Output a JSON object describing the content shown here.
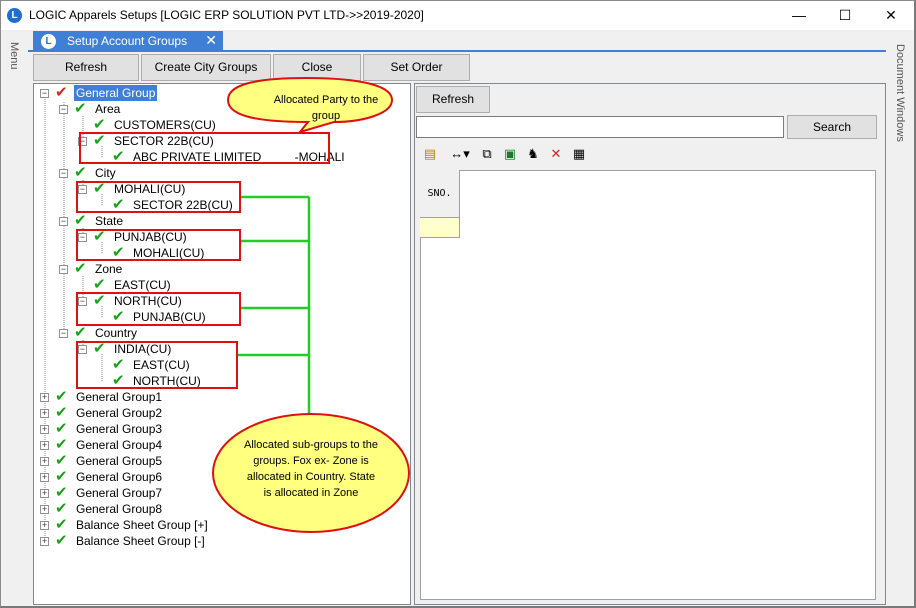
{
  "window": {
    "title": "LOGIC Apparels Setups  [LOGIC ERP SOLUTION PVT LTD->>2019-2020]",
    "app_icon_glyph": "L",
    "minimize": "—",
    "maximize": "☐",
    "close": "✕"
  },
  "left_rail": {
    "label": "Menu"
  },
  "right_rail": {
    "label": "Document Windows"
  },
  "tab": {
    "label": "Setup Account Groups",
    "close": "✕"
  },
  "toolbar": {
    "refresh": "Refresh",
    "create_city_groups": "Create City Groups",
    "close": "Close",
    "set_order": "Set Order"
  },
  "tree": {
    "root": "General Group",
    "area": "Area",
    "customers": "CUSTOMERS(CU)",
    "sector22b": "SECTOR 22B(CU)",
    "abc_party": "ABC PRIVATE LIMITED          -MOHALI",
    "city": "City",
    "city_mohali": "MOHALI(CU)",
    "city_sector22b": "SECTOR 22B(CU)",
    "state": "State",
    "state_punjab": "PUNJAB(CU)",
    "state_mohali": "MOHALI(CU)",
    "zone": "Zone",
    "zone_east": "EAST(CU)",
    "zone_north": "NORTH(CU)",
    "zone_punjab": "PUNJAB(CU)",
    "country": "Country",
    "country_india": "INDIA(CU)",
    "country_east": "EAST(CU)",
    "country_north": "NORTH(CU)",
    "groups": [
      "General Group1",
      "General Group2",
      "General Group3",
      "General Group4",
      "General Group5",
      "General Group6",
      "General Group7",
      "General Group8",
      "Balance Sheet Group [+]",
      "Balance Sheet Group [-]"
    ]
  },
  "right": {
    "refresh": "Refresh",
    "search": "Search",
    "search_value": "",
    "grid_header": "SNO.",
    "toolbar_icons": [
      "export-icon",
      "column-resize-icon",
      "copy-icon",
      "excel-icon",
      "find-icon",
      "delete-icon",
      "grid-icon"
    ]
  },
  "callouts": {
    "party": "Allocated  Party  to  the group",
    "subgroups": "Allocated  sub-groups  to the  groups.  Fox  ex- Zone  is  allocated  in Country.  State  is allocated  in  Zone"
  },
  "colors": {
    "accent": "#3f7fd5",
    "check_green": "#1aa31a",
    "root_check": "#d22222",
    "annotation_red": "#e01010",
    "annotation_green": "#22cc22",
    "callout_fill": "#ffff80"
  }
}
